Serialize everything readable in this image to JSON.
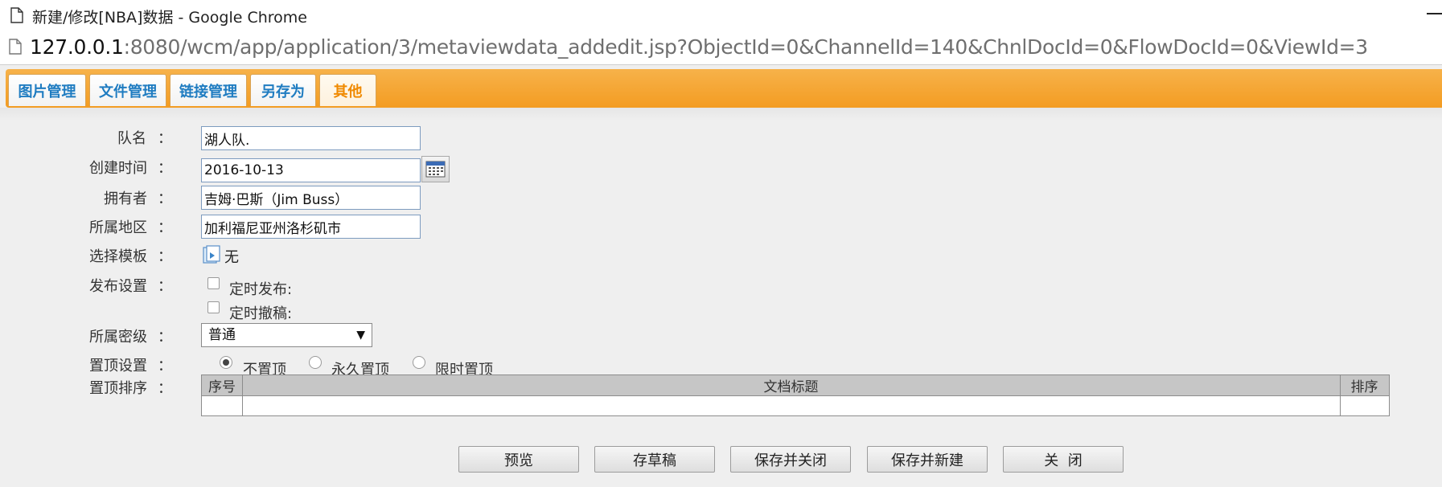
{
  "window": {
    "title": "新建/修改[NBA]数据 - Google Chrome",
    "url_host": "127.0.0.1",
    "url_rest": ":8080/wcm/app/application/3/metaviewdata_addedit.jsp?ObjectId=0&ChannelId=140&ChnlDocId=0&FlowDocId=0&ViewId=3"
  },
  "toolbar": {
    "tabs": [
      {
        "label": "图片管理"
      },
      {
        "label": "文件管理"
      },
      {
        "label": "链接管理"
      },
      {
        "label": "另存为"
      },
      {
        "label": "其他"
      }
    ],
    "accent_color": "#f5a431",
    "tab_text_color": "#1f7cc1",
    "active_tab_color": "#f08a00"
  },
  "form": {
    "colon": "：",
    "team_name": {
      "label": "队名",
      "value": "湖人队."
    },
    "created_time": {
      "label": "创建时间",
      "value": "2016-10-13",
      "icon": "calendar-icon"
    },
    "owner": {
      "label": "拥有者",
      "value": "吉姆·巴斯（Jim Buss）"
    },
    "region": {
      "label": "所属地区",
      "value": "加利福尼亚州洛杉矶市"
    },
    "template": {
      "label": "选择模板",
      "value": "无",
      "icon": "template-icon"
    },
    "publish": {
      "label": "发布设置",
      "scheduled_publish": "定时发布:",
      "scheduled_withdraw": "定时撤稿:"
    },
    "security": {
      "label": "所属密级",
      "selected": "普通"
    },
    "pin": {
      "label": "置顶设置",
      "options": [
        "不置顶",
        "永久置顶",
        "限时置顶"
      ],
      "selected": "不置顶"
    },
    "pin_order": {
      "label": "置顶排序",
      "columns": [
        "序号",
        "文档标题",
        "排序"
      ]
    }
  },
  "actions": {
    "preview": "预览",
    "draft": "存草稿",
    "save_close": "保存并关闭",
    "save_new": "保存并新建",
    "close": "关  闭"
  }
}
